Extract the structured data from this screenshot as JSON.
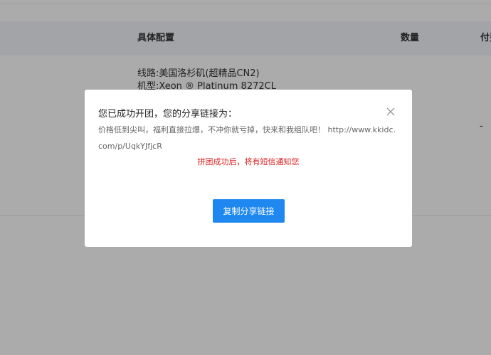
{
  "table": {
    "headers": {
      "config": "具体配置",
      "quantity": "数量",
      "payment": "付费"
    },
    "row": {
      "line": "线路:美国洛杉矶(超精品CN2)",
      "model": "机型:Xeon ® Platinum 8272CL",
      "payment_value": "-"
    }
  },
  "dialog": {
    "title": "您已成功开团，您的分享链接为：",
    "share_text": "价格低到尖叫，福利直接拉爆，不冲你就亏掉，快来和我组队吧！ http://www.kkidc.com/p/UqkYJfjcR",
    "notice": "拼团成功后，将有短信通知您",
    "copy_button_label": "复制分享链接",
    "close_icon": "close-icon"
  },
  "colors": {
    "primary": "#1e88f0",
    "notice": "#e02020",
    "header_bg": "#f2f5fb",
    "overlay": "rgba(0,0,0,0.33)"
  }
}
